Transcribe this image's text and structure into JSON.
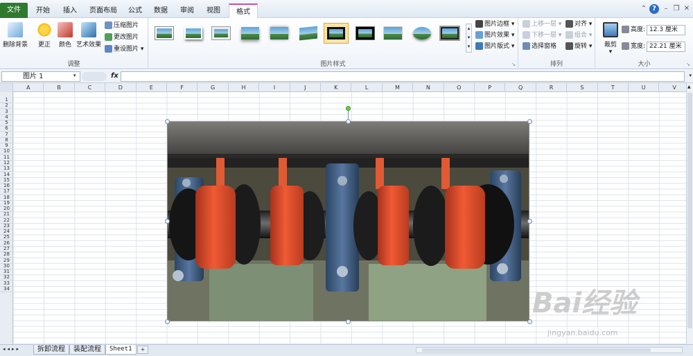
{
  "tabs": [
    {
      "label": "文件"
    },
    {
      "label": "开始"
    },
    {
      "label": "插入"
    },
    {
      "label": "页面布局"
    },
    {
      "label": "公式"
    },
    {
      "label": "数据"
    },
    {
      "label": "审阅"
    },
    {
      "label": "视图"
    },
    {
      "label": "格式"
    }
  ],
  "ribbon": {
    "adjust": {
      "remove_bg": "删除背景",
      "correct": "更正",
      "color": "颜色",
      "art": "艺术效果",
      "compress": "压缩图片",
      "change": "更改图片",
      "reset": "重设图片",
      "label": "调整"
    },
    "styles": {
      "label": "图片样式",
      "border": "图片边框",
      "effect": "图片效果",
      "layout": "图片版式"
    },
    "arrange": {
      "forward": "上移一层",
      "backward": "下移一层",
      "pane": "选择窗格",
      "align": "对齐",
      "group": "组合",
      "rotate": "旋转",
      "label": "排列"
    },
    "size": {
      "crop": "裁剪",
      "height_label": "高度:",
      "height_value": "12.3 厘米",
      "width_label": "宽度:",
      "width_value": "22.21 厘米",
      "label": "大小"
    }
  },
  "formula_bar": {
    "name_box": "图片 1",
    "fx": "fx",
    "content": ""
  },
  "columns": [
    "A",
    "B",
    "C",
    "D",
    "E",
    "F",
    "G",
    "H",
    "I",
    "J",
    "K",
    "L",
    "M",
    "N",
    "O",
    "P",
    "Q",
    "R",
    "S",
    "T",
    "U",
    "V"
  ],
  "rows": [
    "1",
    "2",
    "3",
    "4",
    "5",
    "6",
    "7",
    "8",
    "9",
    "10",
    "11",
    "12",
    "13",
    "14",
    "15",
    "16",
    "17",
    "18",
    "19",
    "20",
    "21",
    "22",
    "23",
    "24",
    "25",
    "26",
    "27",
    "28",
    "29",
    "30",
    "31",
    "32",
    "33",
    "34"
  ],
  "sheets": [
    {
      "label": "拆卸流程"
    },
    {
      "label": "装配流程"
    },
    {
      "label": "Sheet1"
    }
  ],
  "watermark": {
    "brand": "Bai经验",
    "url": "jingyan.baidu.com"
  },
  "colors": {
    "file_tab": "#2f7a2f",
    "context_accent": "#d24fa0"
  }
}
